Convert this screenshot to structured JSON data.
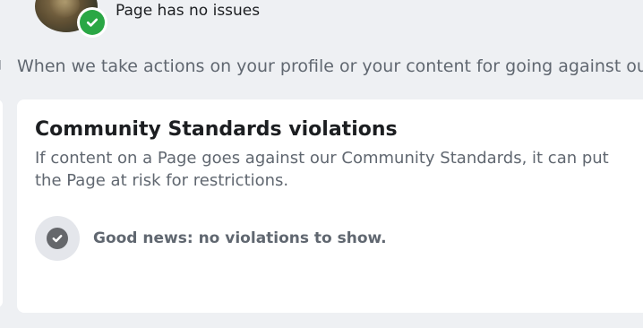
{
  "status": {
    "text": "Page has no issues",
    "badge_icon": "check-circle-icon",
    "badge_color": "#2aa745"
  },
  "info_line": {
    "text": "When we take actions on your profile or your content for going against ou",
    "text_color": "#606770"
  },
  "community_standards_card": {
    "title": "Community Standards violations",
    "description": "If content on a Page goes against our Community Standards, it can put the Page at risk for restrictions.",
    "empty_state": {
      "icon": "check-circle-icon",
      "text": "Good news: no violations to show."
    }
  },
  "colors": {
    "background": "#eef0f3",
    "card": "#ffffff",
    "secondary_text": "#606770",
    "primary_text": "#1c1e21"
  }
}
